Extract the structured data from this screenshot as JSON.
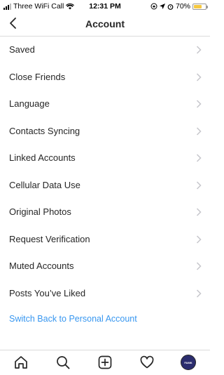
{
  "status_bar": {
    "carrier": "Three WiFi Call",
    "time": "12:31 PM",
    "battery": "70%",
    "battery_level": 0.7
  },
  "header": {
    "title": "Account",
    "back_icon": "chevron-left-icon"
  },
  "menu": {
    "items": [
      {
        "label": "Saved"
      },
      {
        "label": "Close Friends"
      },
      {
        "label": "Language"
      },
      {
        "label": "Contacts Syncing"
      },
      {
        "label": "Linked Accounts"
      },
      {
        "label": "Cellular Data Use"
      },
      {
        "label": "Original Photos"
      },
      {
        "label": "Request Verification"
      },
      {
        "label": "Muted Accounts"
      },
      {
        "label": "Posts You’ve Liked"
      }
    ],
    "switch_link": "Switch Back to Personal Account"
  },
  "tab_bar": {
    "items": [
      "home-icon",
      "search-icon",
      "add-post-icon",
      "activity-heart-icon",
      "profile-avatar"
    ]
  },
  "colors": {
    "link": "#3897f0",
    "text": "#262626",
    "chevron": "#c7c7cc",
    "battery": "#f5c842"
  }
}
